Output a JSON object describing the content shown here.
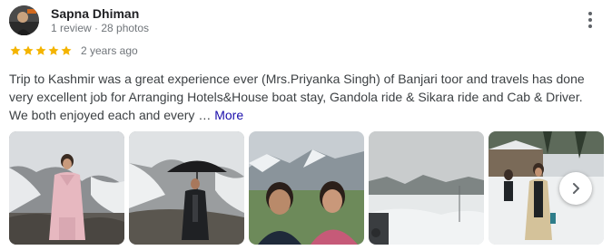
{
  "reviewer": {
    "name": "Sapna Dhiman",
    "meta": "1 review · 28 photos"
  },
  "rating": {
    "stars": 5,
    "max_stars": 5,
    "date": "2 years ago",
    "star_color": "#f4b400"
  },
  "review": {
    "text": "Trip to Kashmir was a great experience ever (Mrs.Priyanka Singh) of Banjari toor and travels has done very excellent job for Arranging Hotels&House boat stay, Gandola ride & Sikara ride and Cab & Driver. We both enjoyed each and every … ",
    "more_label": "More",
    "link_color": "#1a0dab"
  },
  "photos": [
    {
      "subject": "woman-in-pink-coat-snowy-rocks"
    },
    {
      "subject": "man-with-umbrella-snowy-rocks"
    },
    {
      "subject": "couple-selfie-mountains"
    },
    {
      "subject": "foggy-snow-valley"
    },
    {
      "subject": "woman-in-snow-village"
    }
  ],
  "icons": {
    "more_options": "more-vertical-icon",
    "next": "chevron-right-icon",
    "star": "star-icon"
  }
}
